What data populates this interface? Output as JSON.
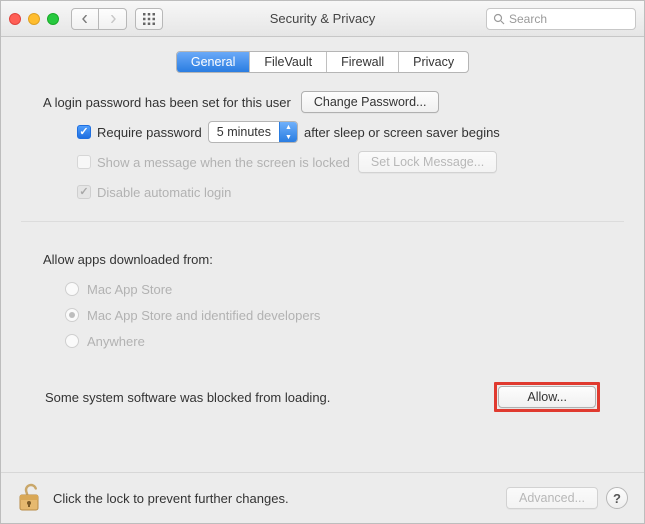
{
  "window": {
    "title": "Security & Privacy",
    "search_placeholder": "Search"
  },
  "tabs": [
    {
      "label": "General",
      "active": true
    },
    {
      "label": "FileVault",
      "active": false
    },
    {
      "label": "Firewall",
      "active": false
    },
    {
      "label": "Privacy",
      "active": false
    }
  ],
  "login": {
    "password_set_text": "A login password has been set for this user",
    "change_password_btn": "Change Password...",
    "require_password_label": "Require password",
    "require_password_delay": "5 minutes",
    "after_sleep_text": "after sleep or screen saver begins",
    "show_message_label": "Show a message when the screen is locked",
    "set_lock_message_btn": "Set Lock Message...",
    "disable_auto_login_label": "Disable automatic login"
  },
  "gatekeeper": {
    "heading": "Allow apps downloaded from:",
    "opt_appstore": "Mac App Store",
    "opt_identified": "Mac App Store and identified developers",
    "opt_anywhere": "Anywhere",
    "blocked_text": "Some system software was blocked from loading.",
    "allow_btn": "Allow..."
  },
  "footer": {
    "lock_text": "Click the lock to prevent further changes.",
    "advanced_btn": "Advanced...",
    "help": "?"
  }
}
